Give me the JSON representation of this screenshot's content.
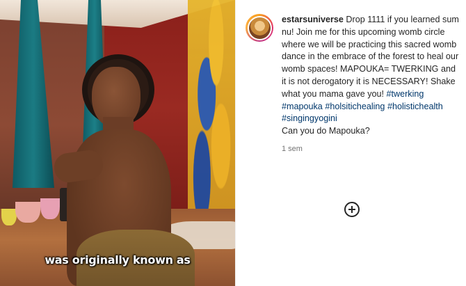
{
  "video": {
    "caption": "was originally known as"
  },
  "post": {
    "username": "estarsuniverse",
    "caption_parts": [
      "Drop 1111 if you learned sum nu! Join me for this upcoming womb circle where we will be practicing this sacred womb dance in the embrace of the forest to heal our womb spaces! MAPOUKA= TWERKING and it is not derogatory it is NECESSARY! Shake what you mama gave you!"
    ],
    "hashtags": [
      "#twerking",
      "#mapouka",
      "#holsitichealing",
      "#holistichealth",
      "#singingyogini"
    ],
    "question": "Can you do Mapouka?",
    "time": "1 sem"
  },
  "icons": {
    "avatar": "profile-avatar",
    "load_more": "plus-circle-icon"
  },
  "colors": {
    "text": "#262626",
    "hashtag": "#00376b",
    "muted": "#737373"
  }
}
